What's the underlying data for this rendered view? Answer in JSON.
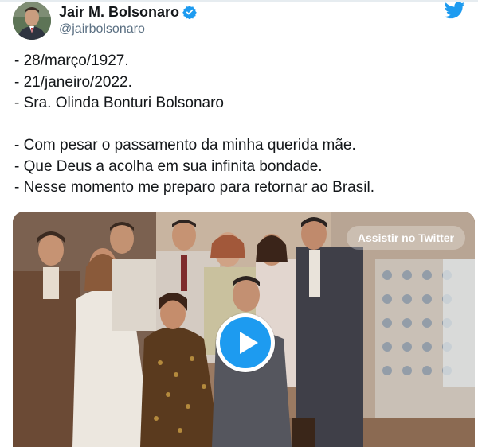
{
  "tweet": {
    "author": {
      "display_name": "Jair M. Bolsonaro",
      "handle": "@jairbolsonaro",
      "verified_icon": "verified-badge-icon",
      "avatar": "profile-photo"
    },
    "brand_icon": "twitter-bird-icon",
    "text_lines": [
      "- 28/março/1927.",
      "- 21/janeiro/2022.",
      "- Sra. Olinda Bonturi Bolsonaro",
      "",
      "- Com pesar o passamento da minha querida mãe.",
      "- Que Deus a acolha em sua infinita bondade.",
      "- Nesse momento me preparo para retornar ao Brasil."
    ],
    "media": {
      "type": "video",
      "watch_label": "Assistir no Twitter",
      "play_icon": "play-icon"
    }
  },
  "colors": {
    "text": "#14171a",
    "secondary": "#5b7083",
    "accent": "#1d9bf0"
  }
}
